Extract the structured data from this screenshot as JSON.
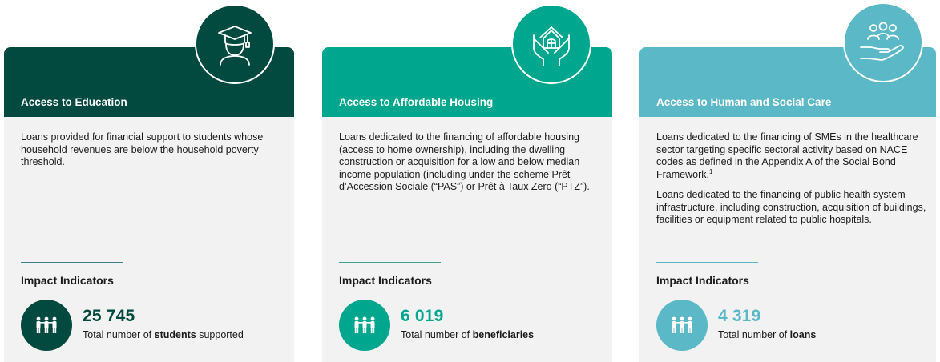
{
  "cards": [
    {
      "title": "Access to Education",
      "icon": "graduate-icon",
      "description": [
        "Loans provided for financial support to students whose household revenues are below the household poverty threshold."
      ],
      "impact_title": "Impact Indicators",
      "metric": {
        "value": "25 745",
        "label_prefix": "Total number of ",
        "label_bold": "students",
        "label_suffix": " supported"
      }
    },
    {
      "title": "Access to Affordable Housing",
      "icon": "house-in-hands-icon",
      "description": [
        "Loans dedicated to the financing of affordable housing (access to home ownership), including the dwelling construction or acquisition for a low and below median income population (including under the scheme Prêt d’Accession Sociale (“PAS”) or Prêt à Taux Zero (“PTZ”)."
      ],
      "impact_title": "Impact Indicators",
      "metric": {
        "value": "6 019",
        "label_prefix": "Total number of ",
        "label_bold": "beneficiaries",
        "label_suffix": ""
      }
    },
    {
      "title": "Access to Human and Social Care",
      "icon": "people-care-hand-icon",
      "description": [
        "Loans dedicated to the financing of SMEs in the healthcare sector targeting specific sectoral activity based on NACE codes as defined in the Appendix A of the Social Bond Framework.",
        "Loans dedicated to the financing of public health system infrastructure, including construction, acquisition of buildings, facilities or equipment related to public hospitals."
      ],
      "footnote_mark": "1",
      "impact_title": "Impact Indicators",
      "metric": {
        "value": "4 319",
        "label_prefix": "Total number of ",
        "label_bold": "loans",
        "label_suffix": ""
      }
    }
  ],
  "colors": {
    "education": "#02493f",
    "housing": "#00a78e",
    "social_care": "#5bb8c6",
    "card_background": "#f2f2f2"
  }
}
